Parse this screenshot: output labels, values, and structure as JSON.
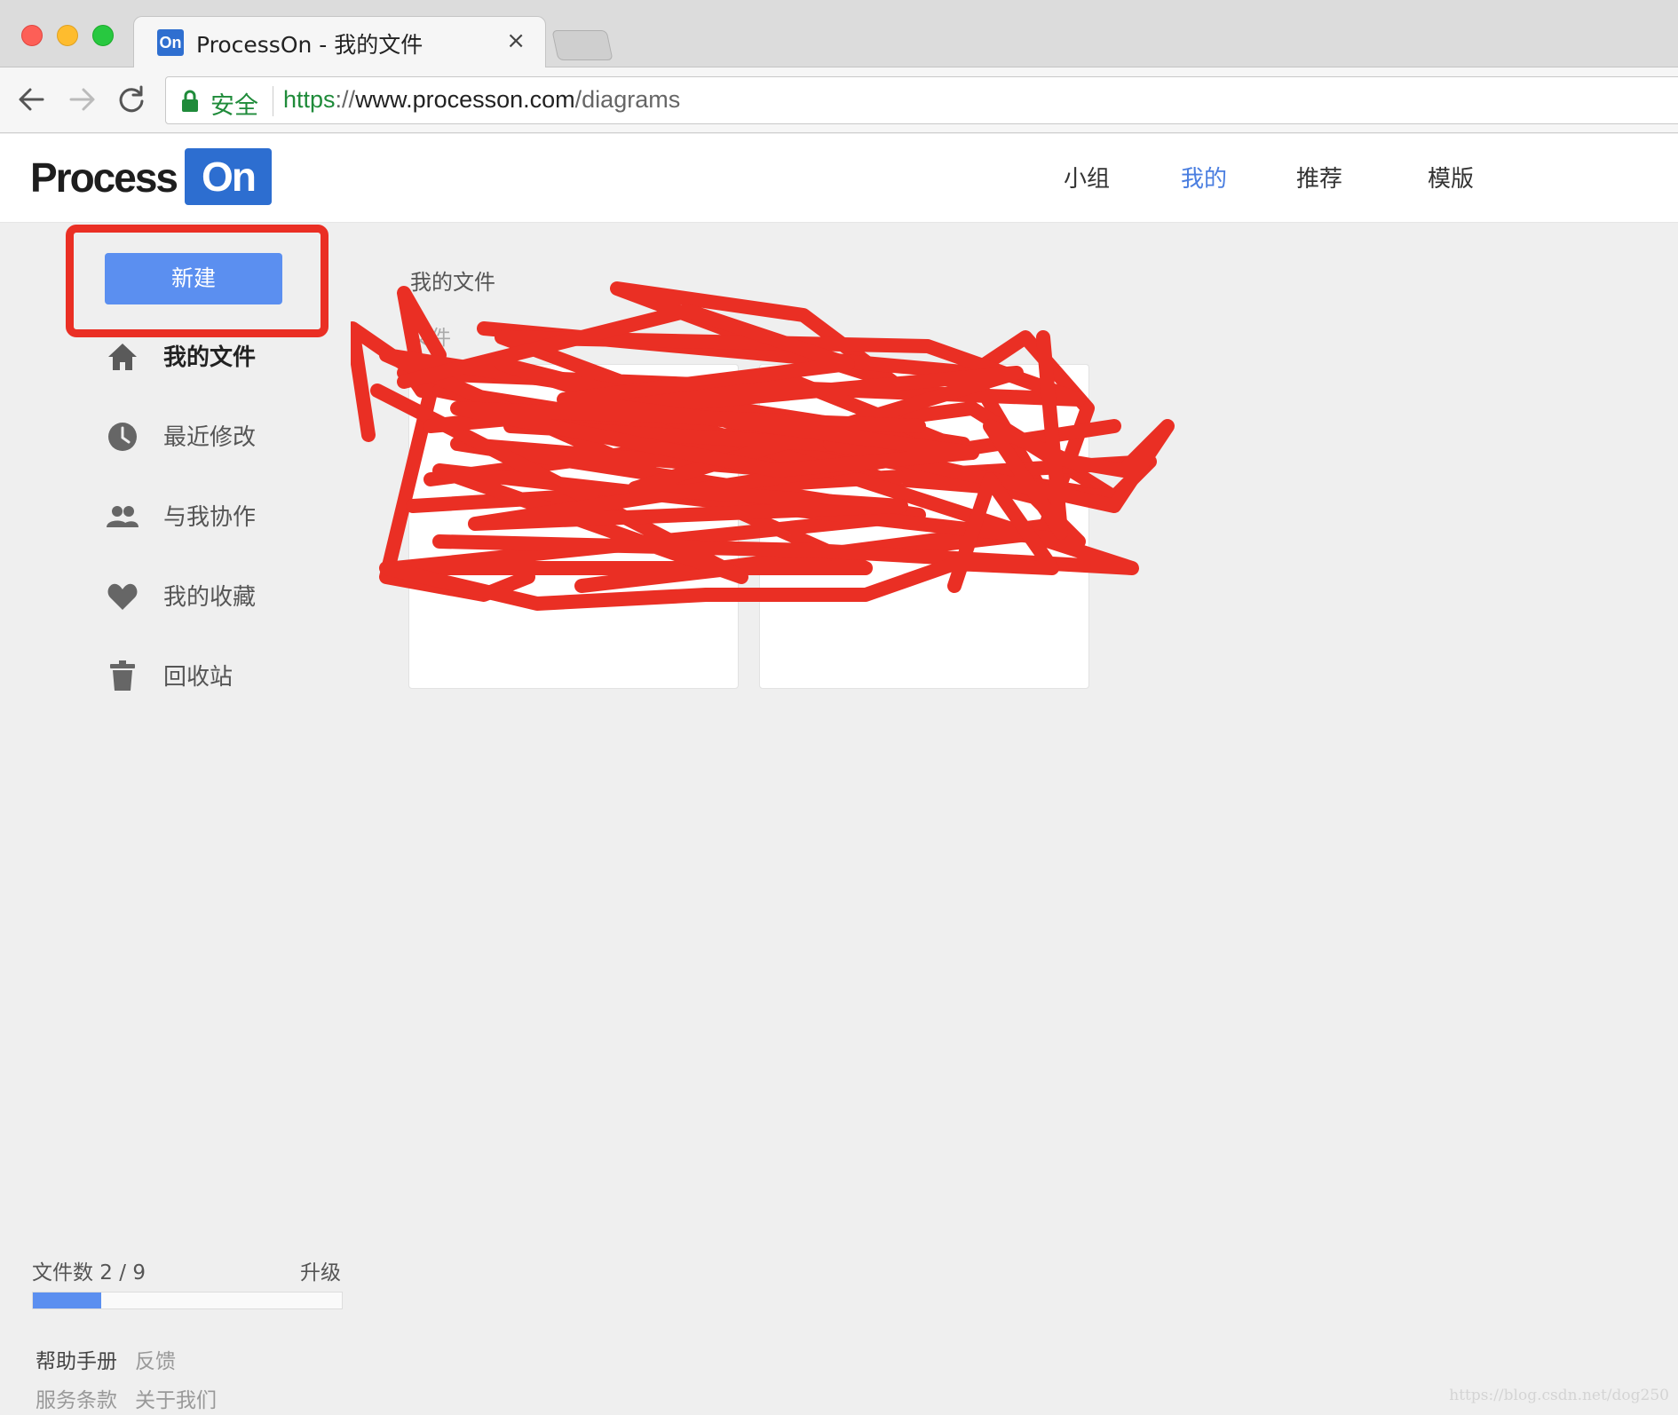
{
  "browser": {
    "tab_title": "ProcessOn - 我的文件",
    "favicon_text": "On",
    "close_glyph": "×",
    "secure_label": "安全",
    "url": {
      "scheme": "https",
      "sep": "://",
      "host": "www.processon.com",
      "path": "/diagrams"
    }
  },
  "app": {
    "logo_text": "Process",
    "logo_on": "On",
    "topnav": [
      {
        "label": "小组"
      },
      {
        "label": "我的",
        "active": true
      },
      {
        "label": "推荐"
      },
      {
        "label": "模版"
      }
    ],
    "accent_color": "#5b8ff0",
    "annotation_color": "#ea2f24"
  },
  "sidebar": {
    "new_button": "新建",
    "items": [
      {
        "label": "我的文件",
        "icon": "home-icon",
        "active": true
      },
      {
        "label": "最近修改",
        "icon": "clock-icon"
      },
      {
        "label": "与我协作",
        "icon": "people-icon"
      },
      {
        "label": "我的收藏",
        "icon": "heart-icon"
      },
      {
        "label": "回收站",
        "icon": "trash-icon"
      }
    ],
    "file_count_label": "文件数 2 / 9",
    "file_count_fraction": 0.2222,
    "upgrade_label": "升级",
    "footer_links": {
      "help": "帮助手册",
      "feedback": "反馈",
      "terms": "服务条款",
      "about": "关于我们"
    }
  },
  "main": {
    "section_title": "我的文件",
    "files_heading": "文件"
  },
  "watermark": "https://blog.csdn.net/dog250"
}
